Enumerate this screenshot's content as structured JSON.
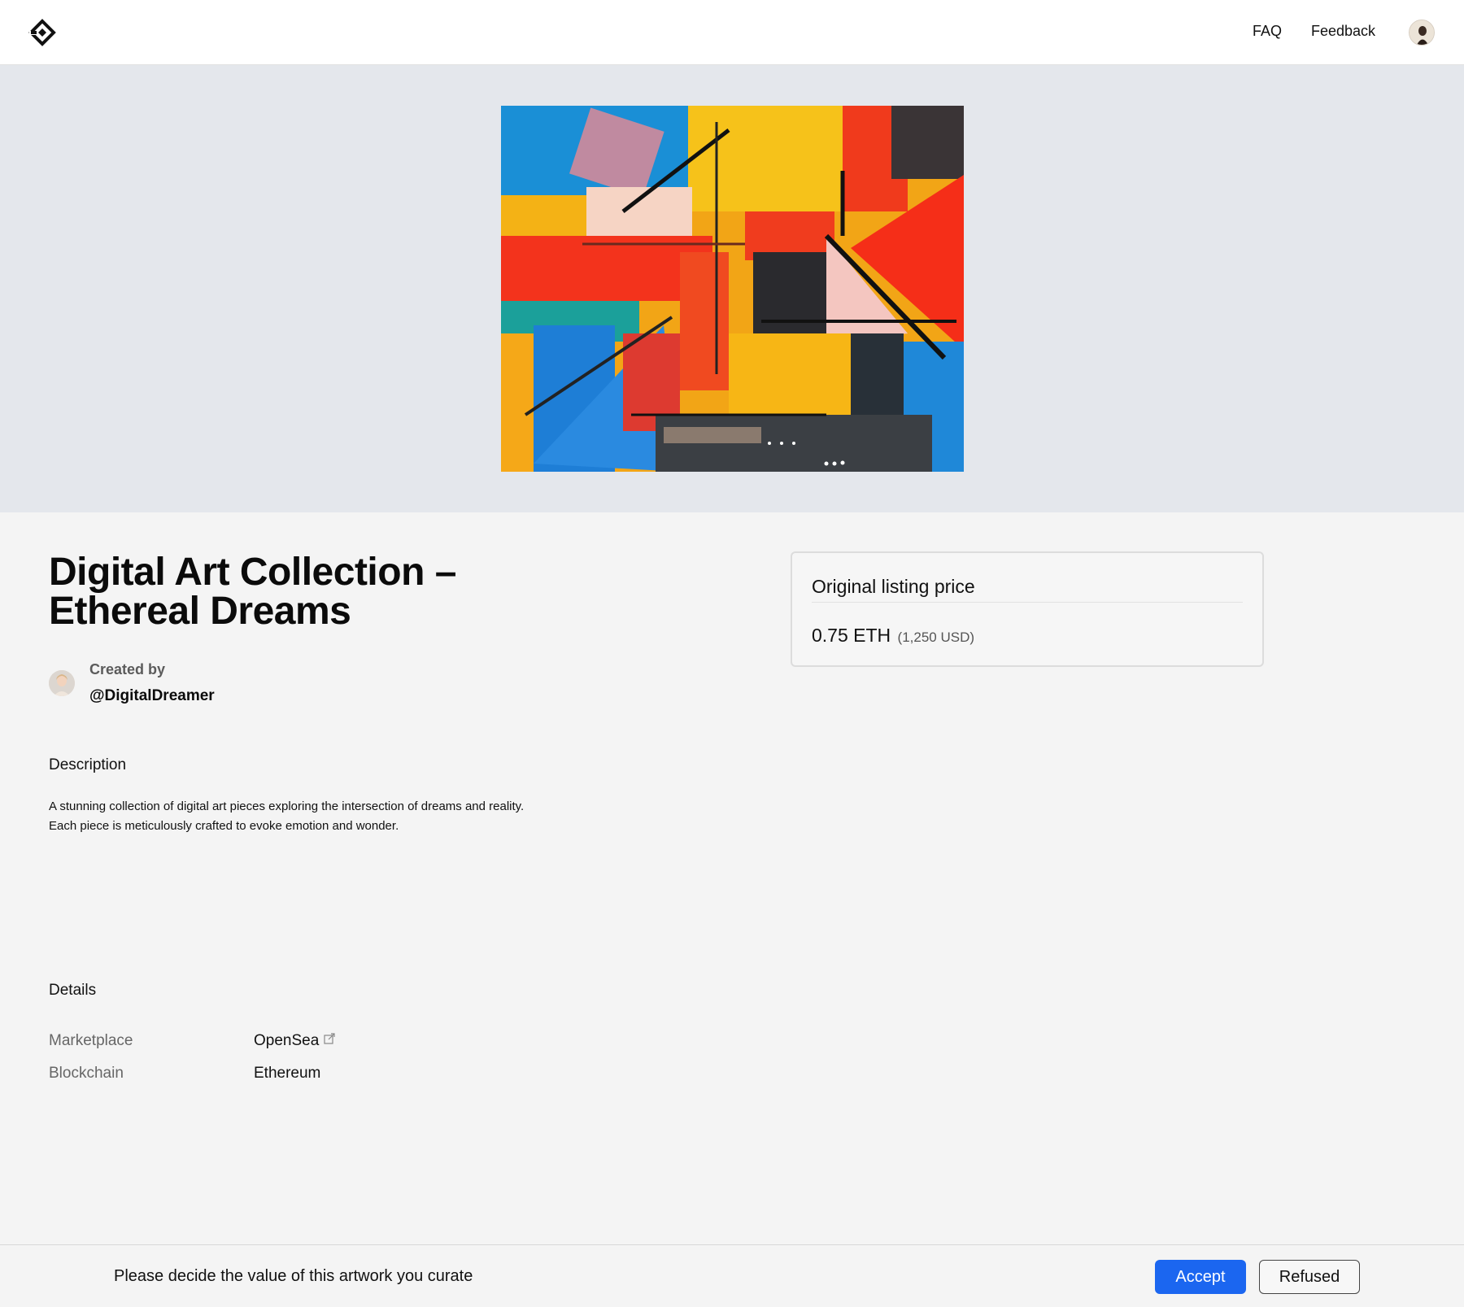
{
  "header": {
    "logo_icon": "diamond-logo-icon",
    "nav": {
      "faq": "FAQ",
      "feedback": "Feedback"
    },
    "avatar_icon": "user-avatar-icon"
  },
  "artwork": {
    "image_icon": "abstract-painting-image"
  },
  "item": {
    "title": "Digital Art Collection – Ethereal Dreams",
    "created_by_label": "Created by",
    "creator": "@DigitalDreamer"
  },
  "description": {
    "heading": "Description",
    "text": "A stunning collection of digital art pieces exploring the intersection of dreams and reality. Each piece is meticulously crafted to evoke emotion and wonder."
  },
  "details": {
    "heading": "Details",
    "rows": [
      {
        "label": "Marketplace",
        "value": "OpenSea"
      },
      {
        "label": "Blockchain",
        "value": "Ethereum"
      }
    ]
  },
  "price": {
    "title": "Original listing price",
    "eth": "0.75 ETH",
    "usd": "(1,250 USD)"
  },
  "bottom": {
    "prompt": "Please decide the value of this artwork you curate",
    "accept": "Accept",
    "refuse": "Refused"
  },
  "colors": {
    "accent": "#1b66f0",
    "hero_bg": "#e4e7ec",
    "page_bg": "#f4f4f4"
  }
}
